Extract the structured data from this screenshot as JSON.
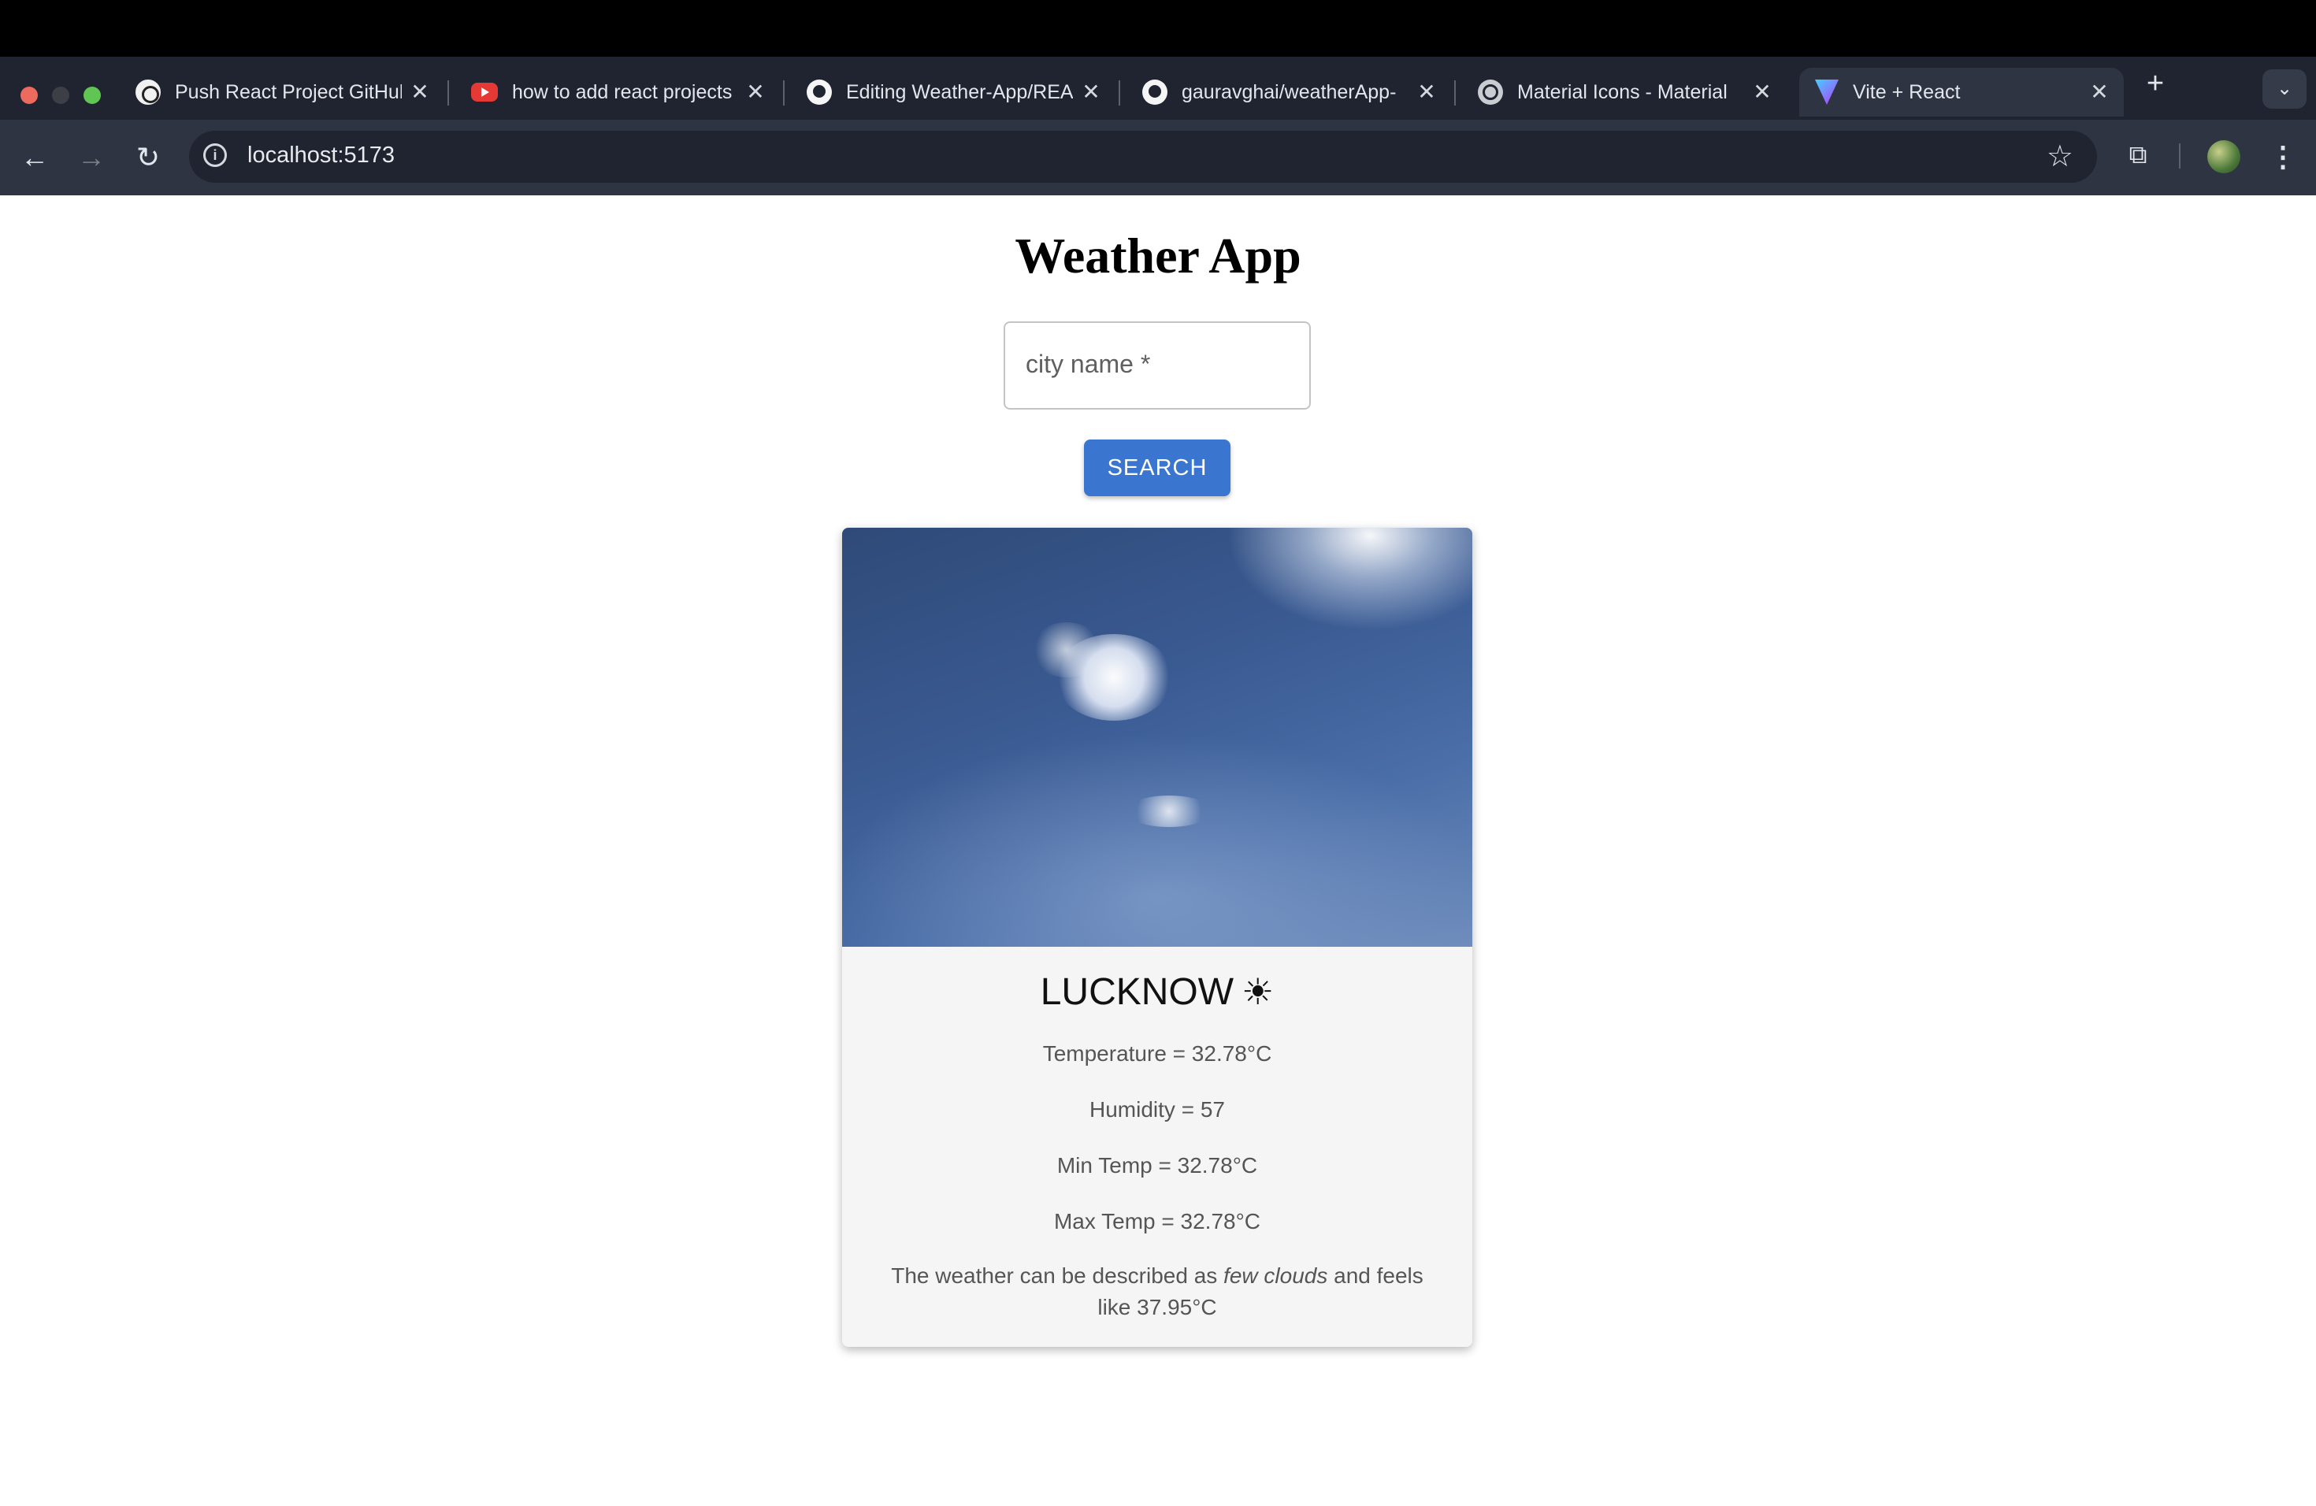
{
  "browser": {
    "tabs": [
      {
        "title": "Push React Project GitHub",
        "icon": "openai-icon"
      },
      {
        "title": "how to add react projects",
        "icon": "youtube-icon"
      },
      {
        "title": "Editing Weather-App/README",
        "icon": "github-icon"
      },
      {
        "title": "gauravghai/weatherApp-",
        "icon": "github-icon"
      },
      {
        "title": "Material Icons - Material",
        "icon": "globe-icon"
      },
      {
        "title": "Vite + React",
        "icon": "vite-icon",
        "active": true
      }
    ],
    "url": "localhost:5173"
  },
  "app": {
    "title": "Weather App",
    "search": {
      "placeholder": "city name",
      "required_mark": "*",
      "button_label": "SEARCH"
    },
    "card": {
      "city": "LUCKNOW",
      "weather_icon": "☀",
      "temperature": "Temperature = 32.78°C",
      "humidity": "Humidity = 57",
      "min_temp": "Min Temp = 32.78°C",
      "max_temp": "Max Temp = 32.78°C",
      "description_prefix": "The weather can be described as",
      "description_condition": "few clouds",
      "description_suffix": "and feels like 37.95°C"
    }
  }
}
